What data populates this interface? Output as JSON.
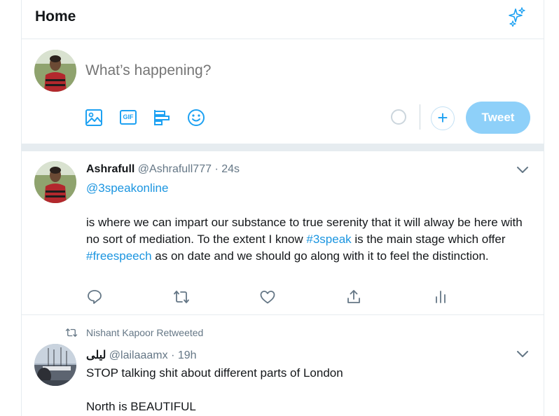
{
  "header": {
    "title": "Home",
    "icon": "sparkle-icon"
  },
  "compose": {
    "placeholder": "What’s happening?",
    "tools": [
      "image-icon",
      "gif-icon",
      "poll-icon",
      "emoji-icon"
    ],
    "gif_label": "GIF",
    "add_label": "+",
    "tweet_button": "Tweet"
  },
  "tweets": [
    {
      "name": "Ashrafull",
      "handle": "@Ashrafull777",
      "time": "· 24s",
      "mention": "@3speakonline",
      "body_a": "is where we can impart our substance to true serenity that it will alway be here with no sort of mediation. To the extent I know ",
      "hashtag1": "#3speak",
      "body_b": " is the main stage which offer ",
      "hashtag2": "#freespeech",
      "body_c": " as on date and we should go along with it to feel the distinction."
    },
    {
      "retweeted_by": "Nishant Kapoor Retweeted",
      "name": "ليلى",
      "handle": "@lailaaamx",
      "time": "· 19h",
      "line1": "STOP talking shit about different parts of London",
      "line2": "North is BEAUTIFUL"
    }
  ],
  "colors": {
    "accent": "#1da1f2",
    "link": "#1b95e0",
    "tweet_button_disabled": "#8ed0f9",
    "muted": "#657786",
    "divider": "#e6ecf0"
  }
}
